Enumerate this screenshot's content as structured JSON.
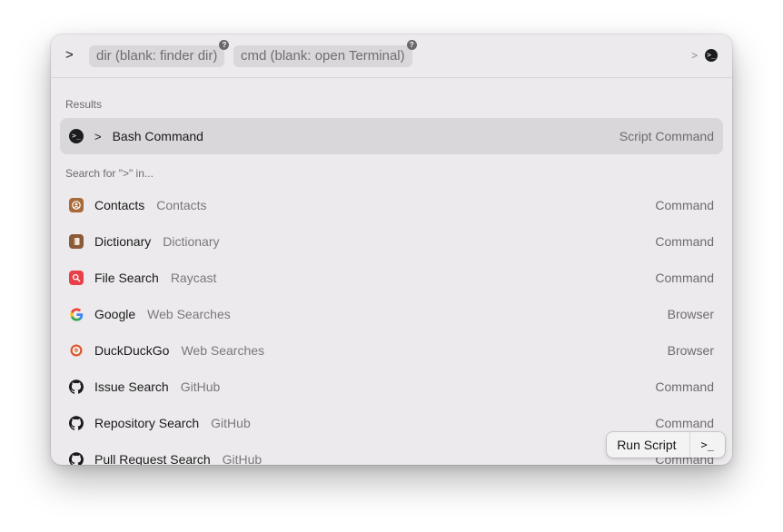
{
  "search": {
    "query": ">",
    "args": [
      {
        "label": "dir (blank: finder dir)",
        "help": "?"
      },
      {
        "label": "cmd (blank: open Terminal)",
        "help": "?"
      }
    ],
    "right_hint": ">",
    "right_icon": "terminal-icon"
  },
  "sections": {
    "results": "Results",
    "search_for": "Search for \">\" in..."
  },
  "results": [
    {
      "prefix": ">",
      "title": "Bash Command",
      "subtitle": "",
      "accessory": "Script Command",
      "icon": "terminal-icon",
      "selected": true
    }
  ],
  "search_items": [
    {
      "title": "Contacts",
      "subtitle": "Contacts",
      "accessory": "Command",
      "icon": "contacts-icon",
      "color": "#a86a3a"
    },
    {
      "title": "Dictionary",
      "subtitle": "Dictionary",
      "accessory": "Command",
      "icon": "dictionary-icon",
      "color": "#8a5a3a"
    },
    {
      "title": "File Search",
      "subtitle": "Raycast",
      "accessory": "Command",
      "icon": "file-search-icon",
      "color": "#e8404a"
    },
    {
      "title": "Google",
      "subtitle": "Web Searches",
      "accessory": "Browser",
      "icon": "google-icon",
      "color": "#4285f4"
    },
    {
      "title": "DuckDuckGo",
      "subtitle": "Web Searches",
      "accessory": "Browser",
      "icon": "duckduckgo-icon",
      "color": "#de5833"
    },
    {
      "title": "Issue Search",
      "subtitle": "GitHub",
      "accessory": "Command",
      "icon": "github-icon",
      "color": "#1a1a1a"
    },
    {
      "title": "Repository Search",
      "subtitle": "GitHub",
      "accessory": "Command",
      "icon": "github-icon",
      "color": "#1a1a1a"
    },
    {
      "title": "Pull Request Search",
      "subtitle": "GitHub",
      "accessory": "Command",
      "icon": "github-icon",
      "color": "#1a1a1a"
    }
  ],
  "action_bar": {
    "primary": "Run Script",
    "shortcut": ">_"
  }
}
